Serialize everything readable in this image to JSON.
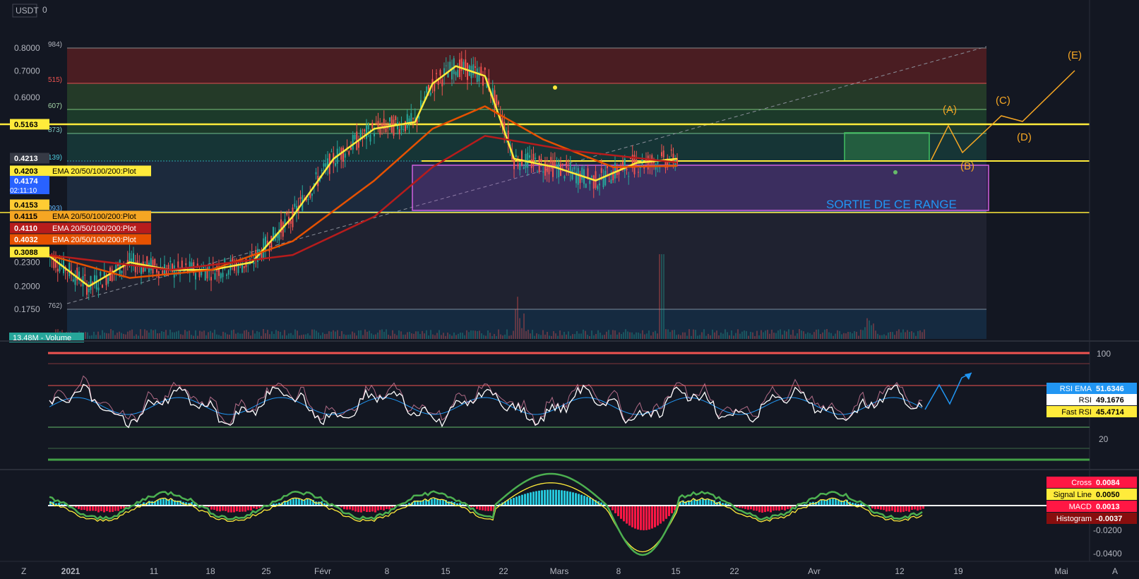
{
  "currency": "USDT",
  "price_top_tick": "0",
  "main_price_ticks": [
    "0.8000",
    "0.7000",
    "0.6000",
    "0.2300",
    "0.2000",
    "0.1750"
  ],
  "fib_labels": [
    "984)",
    "515)",
    "607)",
    "873)",
    "139)",
    "093)",
    "762)"
  ],
  "price_tags": [
    {
      "value": "0.5163",
      "bg": "#ffeb3b",
      "fg": "#000000"
    },
    {
      "value": "0.4213",
      "bg": "#363a45",
      "fg": "#ffffff"
    },
    {
      "value": "0.4203",
      "bg": "#ffeb3b",
      "fg": "#000000",
      "legend": "EMA 20/50/100/200:Plot",
      "legend_bg": "#ffeb3b"
    },
    {
      "value": "0.4174",
      "sub": "02:11:10",
      "bg": "#2962ff",
      "fg": "#ffffff"
    },
    {
      "value": "0.4153",
      "bg": "#ffcc33",
      "fg": "#000000"
    },
    {
      "value": "0.4115",
      "bg": "#f5a623",
      "fg": "#000000",
      "legend": "EMA 20/50/100/200:Plot",
      "legend_bg": "#f5a623"
    },
    {
      "value": "0.4110",
      "bg": "#b71c1c",
      "fg": "#ffffff",
      "legend": "EMA 20/50/100/200:Plot",
      "legend_bg": "#b71c1c"
    },
    {
      "value": "0.4032",
      "bg": "#e65100",
      "fg": "#ffffff",
      "legend": "EMA 20/50/100/200:Plot",
      "legend_bg": "#e65100"
    },
    {
      "value": "0.3088",
      "bg": "#ffeb3b",
      "fg": "#000000"
    }
  ],
  "volume_label": "13.48M - Volume",
  "range_annotation": "SORTIE DE CE RANGE",
  "wave_labels": [
    "(A)",
    "(B)",
    "(C)",
    "(D)",
    "(E)"
  ],
  "rsi": {
    "ticks": [
      "100",
      "20"
    ],
    "tags": [
      {
        "name": "RSI EMA",
        "value": "51.6346",
        "bg": "#2196f3",
        "fg": "#ffffff"
      },
      {
        "name": "RSI",
        "value": "49.1676",
        "bg": "#ffffff",
        "fg": "#000000"
      },
      {
        "name": "Fast RSI",
        "value": "45.4714",
        "bg": "#ffeb3b",
        "fg": "#000000"
      }
    ]
  },
  "macd": {
    "ticks": [
      "-0.0200",
      "-0.0400"
    ],
    "tags": [
      {
        "name": "Cross",
        "value": "0.0084",
        "bg": "#ff1744",
        "fg": "#ffffff"
      },
      {
        "name": "Signal Line",
        "value": "0.0050",
        "bg": "#ffeb3b",
        "fg": "#000000"
      },
      {
        "name": "MACD",
        "value": "0.0013",
        "bg": "#ff1744",
        "fg": "#ffffff"
      },
      {
        "name": "Histogram",
        "value": "-0.0037",
        "bg": "#880e0e",
        "fg": "#ffffff"
      }
    ]
  },
  "time_axis": [
    "2021",
    "11",
    "18",
    "25",
    "Févr",
    "8",
    "15",
    "22",
    "Mars",
    "8",
    "15",
    "22",
    "Avr",
    "12",
    "19",
    "Mai"
  ],
  "corner_icons": {
    "left": "Z",
    "right": "A"
  },
  "chart_data": {
    "type": "line",
    "title": "",
    "ylabel": "USDT",
    "y_scale": "log",
    "ylim": [
      0.15,
      0.9
    ],
    "grid": false,
    "series": [
      {
        "color": "#ffeb3b",
        "x": [
          "2020-12-25",
          "2021-01-01",
          "2021-01-08",
          "2021-01-15",
          "2021-01-22",
          "2021-01-29",
          "2021-02-05",
          "2021-02-12",
          "2021-02-19",
          "2021-02-26",
          "2021-03-01",
          "2021-03-05",
          "2021-03-10",
          "2021-03-15",
          "2021-03-22",
          "2021-03-29",
          "2021-04-05",
          "2021-04-12"
        ],
        "values": [
          0.24,
          0.2,
          0.23,
          0.22,
          0.22,
          0.23,
          0.3,
          0.42,
          0.5,
          0.52,
          0.65,
          0.72,
          0.68,
          0.42,
          0.4,
          0.37,
          0.41,
          0.42
        ]
      },
      {
        "color": "#e65100",
        "x": [
          "2020-12-25",
          "2021-01-08",
          "2021-01-22",
          "2021-02-05",
          "2021-02-19",
          "2021-03-01",
          "2021-03-10",
          "2021-03-20",
          "2021-04-01",
          "2021-04-12"
        ],
        "values": [
          0.24,
          0.21,
          0.22,
          0.26,
          0.37,
          0.5,
          0.57,
          0.47,
          0.4,
          0.403
        ]
      },
      {
        "color": "#b71c1c",
        "x": [
          "2020-12-25",
          "2021-01-15",
          "2021-02-05",
          "2021-02-19",
          "2021-03-01",
          "2021-03-10",
          "2021-03-25",
          "2021-04-12"
        ],
        "values": [
          0.24,
          0.22,
          0.24,
          0.3,
          0.4,
          0.48,
          0.44,
          0.411
        ]
      }
    ],
    "horizontal_levels": [
      0.5163,
      0.4213,
      0.3088
    ],
    "annotations": [
      "SORTIE DE CE RANGE",
      "(A)",
      "(B)",
      "(C)",
      "(D)",
      "(E)"
    ]
  }
}
